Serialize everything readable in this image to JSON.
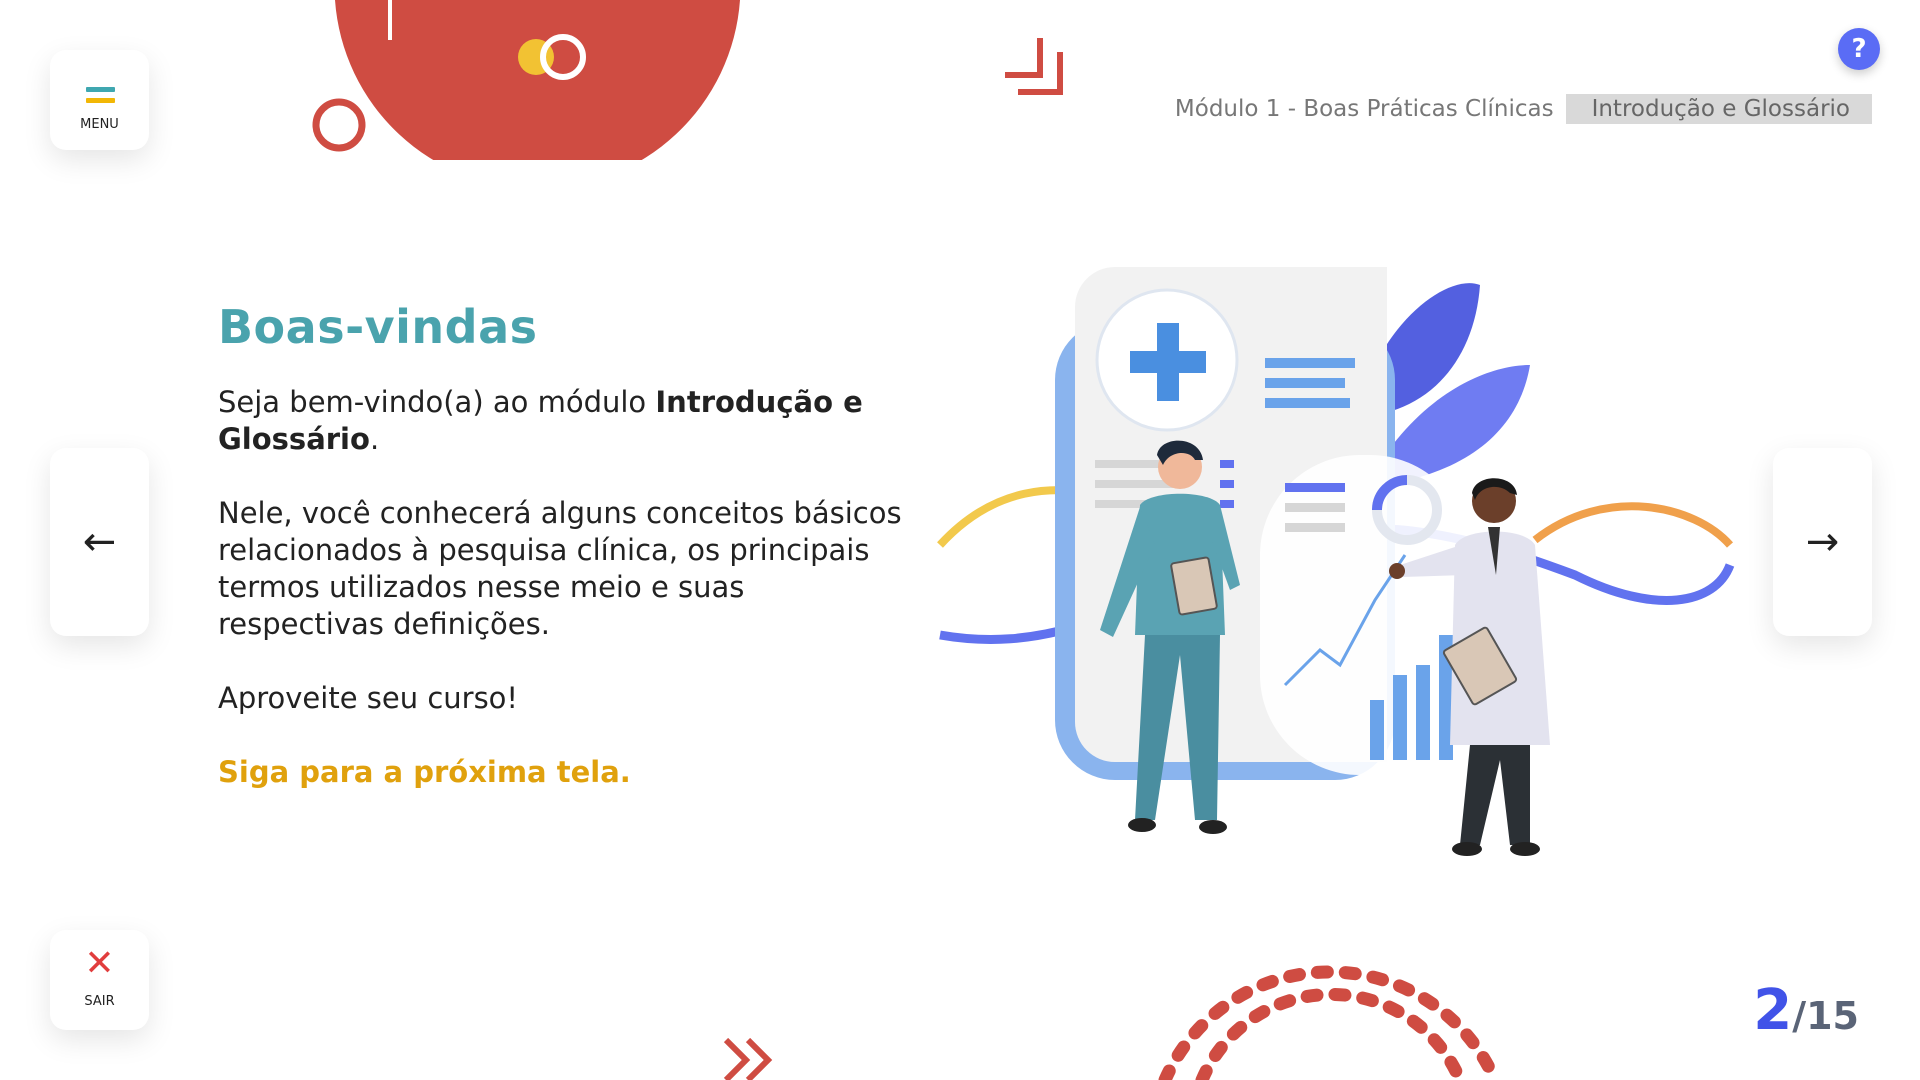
{
  "nav": {
    "menu_label": "MENU",
    "exit_label": "SAIR",
    "help_glyph": "?",
    "prev_glyph": "←",
    "next_glyph": "→",
    "icons": [
      "hamburger-icon",
      "close-icon",
      "arrow-left-icon",
      "arrow-right-icon",
      "help-icon"
    ]
  },
  "breadcrumb": {
    "module": "Módulo 1 - Boas Práticas Clínicas",
    "section": "Introdução e Glossário"
  },
  "content": {
    "title": "Boas-vindas",
    "intro_before": "Seja bem-vindo(a) ao módulo ",
    "intro_bold": "Introdução e Glossário",
    "intro_after": ".",
    "paragraph2": "Nele, você conhecerá alguns conceitos básicos relacionados à pesquisa clínica, os principais termos utilizados nesse meio e suas respectivas definições.",
    "paragraph3": "Aproveite seu curso!",
    "cta": "Siga para a próxima tela."
  },
  "pagination": {
    "current": "2",
    "total": "/15"
  },
  "colors": {
    "accent_teal": "#4aa3ad",
    "accent_orange": "#e0a10d",
    "accent_red": "#d14d41",
    "accent_blue": "#4153e8",
    "help_blue": "#5a6cf5"
  }
}
